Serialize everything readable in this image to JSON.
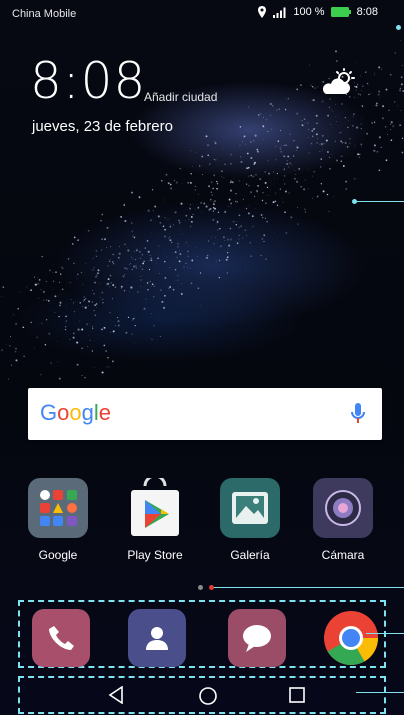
{
  "status_bar": {
    "carrier": "China Mobile",
    "battery_text": "100 %",
    "time": "8:08"
  },
  "home_widget": {
    "clock": "8:08",
    "add_city": "Añadir ciudad",
    "date": "jueves, 23 de febrero",
    "weather_icon": "partly-cloudy-icon"
  },
  "search_bar": {
    "logo_text": "Google"
  },
  "apps": [
    {
      "label": "Google",
      "icon": "google-folder-icon"
    },
    {
      "label": "Play Store",
      "icon": "play-store-icon"
    },
    {
      "label": "Galería",
      "icon": "gallery-icon"
    },
    {
      "label": "Cámara",
      "icon": "camera-icon"
    }
  ],
  "page_indicator": {
    "total": 2,
    "active": 2
  },
  "dock": [
    {
      "icon": "phone-icon"
    },
    {
      "icon": "contacts-icon"
    },
    {
      "icon": "messages-icon"
    },
    {
      "icon": "chrome-icon"
    }
  ],
  "navigation": {
    "buttons": [
      "back-icon",
      "home-icon",
      "recents-icon"
    ]
  },
  "colors": {
    "callout": "#7ee3ee",
    "google_blue": "#4285F4",
    "google_red": "#EA4335",
    "google_yellow": "#FBBC05",
    "google_green": "#34A853",
    "page_dot_active": "#e53935",
    "page_dot_inactive": "#8a8a8a"
  }
}
